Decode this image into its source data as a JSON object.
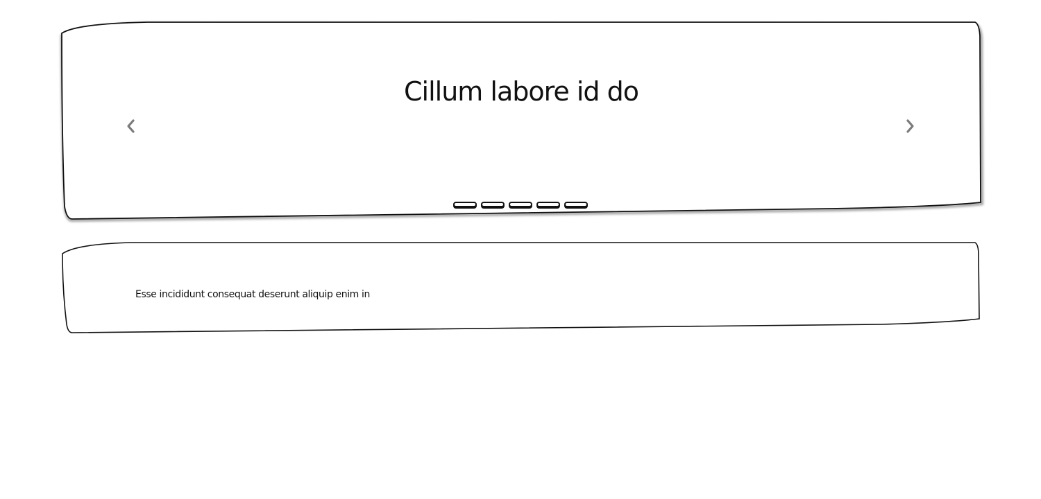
{
  "carousel": {
    "title": "Cillum labore id do",
    "prev_icon": "chevron-left-icon",
    "next_icon": "chevron-right-icon",
    "slide_count": 5,
    "indicators": [
      {
        "label": "Slide 1"
      },
      {
        "label": "Slide 2"
      },
      {
        "label": "Slide 3"
      },
      {
        "label": "Slide 4"
      },
      {
        "label": "Slide 5"
      }
    ],
    "arrow_color": "#7a7a7a"
  },
  "card": {
    "text": "Esse incididunt consequat deserunt aliquip enim in"
  },
  "colors": {
    "ink": "#111111",
    "background": "#ffffff"
  }
}
